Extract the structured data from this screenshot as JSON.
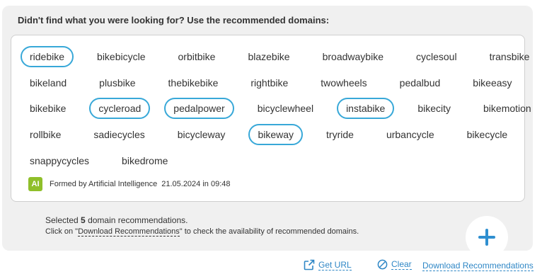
{
  "heading": "Didn't find what you were looking for? Use the recommended domains:",
  "rows": [
    [
      {
        "label": "ridebike",
        "selected": true
      },
      {
        "label": "bikebicycle",
        "selected": false
      },
      {
        "label": "orbitbike",
        "selected": false
      },
      {
        "label": "blazebike",
        "selected": false
      },
      {
        "label": "broadwaybike",
        "selected": false
      },
      {
        "label": "cyclesoul",
        "selected": false
      },
      {
        "label": "transbike",
        "selected": false
      }
    ],
    [
      {
        "label": "bikeland",
        "selected": false
      },
      {
        "label": "plusbike",
        "selected": false
      },
      {
        "label": "thebikebike",
        "selected": false
      },
      {
        "label": "rightbike",
        "selected": false
      },
      {
        "label": "twowheels",
        "selected": false
      },
      {
        "label": "pedalbud",
        "selected": false
      },
      {
        "label": "bikeeasy",
        "selected": false
      }
    ],
    [
      {
        "label": "bikebike",
        "selected": false
      },
      {
        "label": "cycleroad",
        "selected": true
      },
      {
        "label": "pedalpower",
        "selected": true
      },
      {
        "label": "bicyclewheel",
        "selected": false
      },
      {
        "label": "instabike",
        "selected": true
      },
      {
        "label": "bikecity",
        "selected": false
      },
      {
        "label": "bikemotion",
        "selected": false
      }
    ],
    [
      {
        "label": "rollbike",
        "selected": false
      },
      {
        "label": "sadiecycles",
        "selected": false
      },
      {
        "label": "bicycleway",
        "selected": false
      },
      {
        "label": "bikeway",
        "selected": true
      },
      {
        "label": "tryride",
        "selected": false
      },
      {
        "label": "urbancycle",
        "selected": false
      },
      {
        "label": "bikecycle",
        "selected": false
      }
    ],
    [
      {
        "label": "snappycycles",
        "selected": false
      },
      {
        "label": "bikedrome",
        "selected": false
      }
    ]
  ],
  "footer": {
    "badge": "AI",
    "formed_by": "Formed by Artificial Intelligence",
    "date": "21.05.2024 in 09:48"
  },
  "selection": {
    "prefix": "Selected",
    "count": "5",
    "suffix": "domain recommendations.",
    "click_prefix": "Click on \"",
    "click_link": "Download Recommendations",
    "click_suffix": "\" to check the availability of recommended domains."
  },
  "actions": {
    "get_url": "Get URL",
    "clear": "Clear",
    "download": "Download Recommendations"
  },
  "colors": {
    "selected_border": "#38a8d8",
    "link": "#2f87c6",
    "ai_badge": "#8fbf2a",
    "panel_bg": "#f0f0f0"
  },
  "icons": {
    "fab": "plus-icon",
    "get_url": "external-link-icon",
    "clear": "clear-circle-icon"
  }
}
